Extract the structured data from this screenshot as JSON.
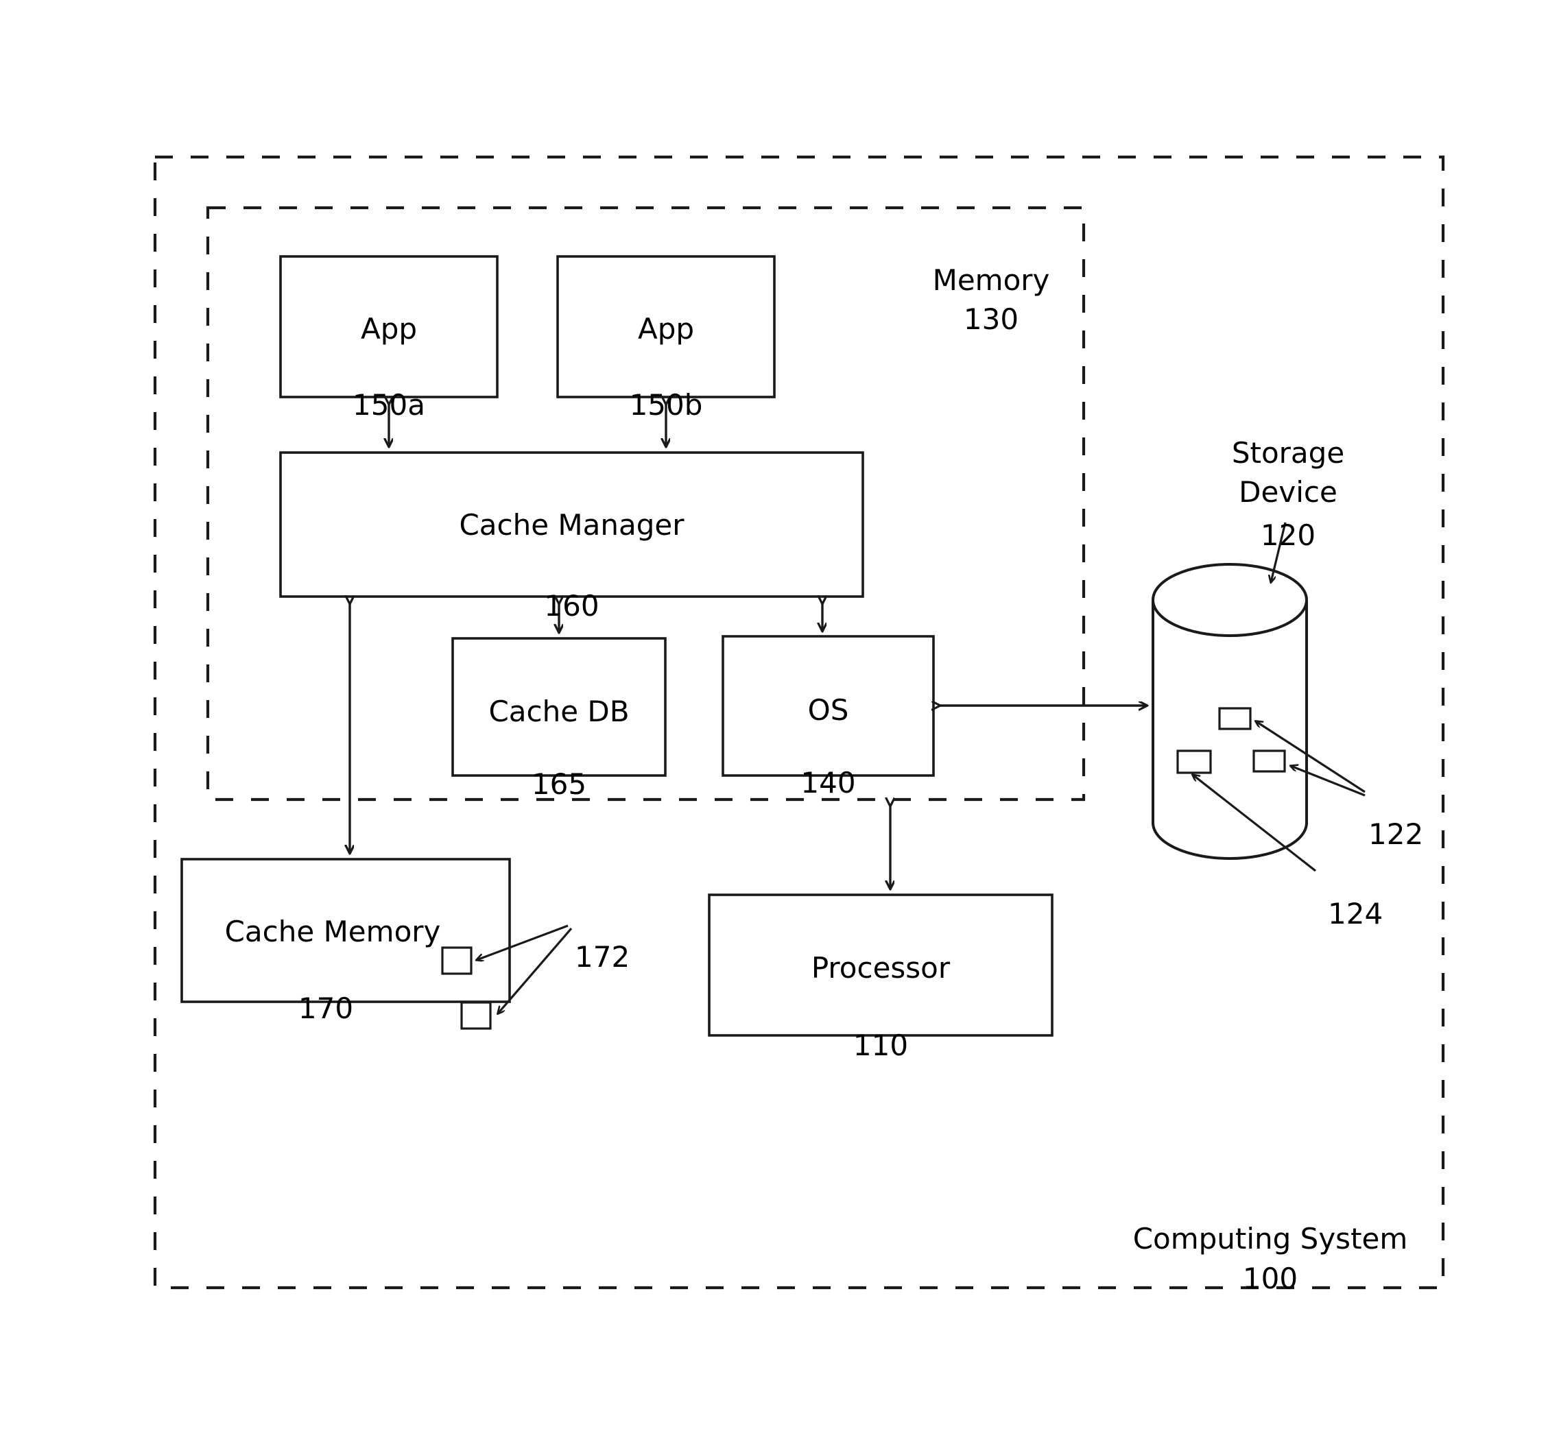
{
  "figure": {
    "type": "block-diagram",
    "title_block": {
      "label": "Computing System",
      "ref": "100"
    },
    "memory_block": {
      "label": "Memory",
      "ref": "130"
    },
    "storage_block": {
      "label": "Storage\nDevice",
      "ref": "120"
    }
  },
  "blocks": [
    {
      "id": "app_a",
      "label": "App",
      "ref": "150a"
    },
    {
      "id": "app_b",
      "label": "App",
      "ref": "150b"
    },
    {
      "id": "cache_manager",
      "label": "Cache Manager",
      "ref": "160"
    },
    {
      "id": "cache_db",
      "label": "Cache DB",
      "ref": "165"
    },
    {
      "id": "os",
      "label": "OS",
      "ref": "140"
    },
    {
      "id": "cache_memory",
      "label": "Cache Memory",
      "ref": "170"
    },
    {
      "id": "processor",
      "label": "Processor",
      "ref": "110"
    }
  ],
  "callouts": [
    {
      "id": "storage_blocks_ref",
      "ref": "122",
      "points_to": "storage-device-data-blocks"
    },
    {
      "id": "storage_block_ref",
      "ref": "124",
      "points_to": "storage-device-data-block"
    },
    {
      "id": "cache_blocks_ref",
      "ref": "172",
      "points_to": "cache-memory-data-blocks"
    }
  ],
  "colors": {
    "stroke": "#1a1a1a",
    "background": "#ffffff",
    "text": "#000000"
  }
}
